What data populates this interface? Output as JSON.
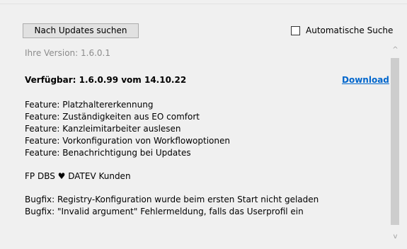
{
  "toolbar": {
    "check_updates_label": "Nach Updates suchen",
    "auto_search_label": "Automatische Suche",
    "auto_search_checked": false
  },
  "info": {
    "version_text": "Ihre Version:  1.6.0.1",
    "available_text": "Verfügbar:  1.6.0.99  vom  14.10.22",
    "download_label": "Download"
  },
  "changelog": {
    "line1": "Feature: Platzhaltererkennung",
    "line2": "Feature: Zuständigkeiten aus EO comfort",
    "line3": "Feature: Kanzleimitarbeiter auslesen",
    "line4": "Feature: Vorkonfiguration von Workflowoptionen",
    "line5": "Feature: Benachrichtigung bei Updates",
    "line6": "FP DBS ♥ DATEV Kunden",
    "line7": "Bugfix: Registry-Konfiguration wurde beim ersten Start nicht geladen",
    "line8": "Bugfix: \"Invalid argument\" Fehlermeldung, falls das Userprofil ein"
  },
  "scrollbar": {
    "up_arrow": "^",
    "down_arrow": "v"
  }
}
